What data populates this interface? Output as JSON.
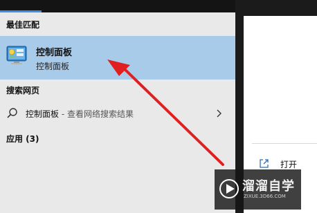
{
  "sections": {
    "best_match": "最佳匹配",
    "web_search": "搜索网页",
    "apps": "应用 (3)"
  },
  "best_match_item": {
    "name": "控制面板",
    "subtitle": "控制面板",
    "icon": "control-panel-icon"
  },
  "web_result": {
    "query": "控制面板",
    "suffix": " - 查看网络搜索结果",
    "icon": "search-icon"
  },
  "right_panel": {
    "open_label": "打开",
    "icon": "open-icon"
  },
  "watermark": {
    "title": "溜溜自学",
    "url": "ZIXUE.3D66.COM"
  },
  "colors": {
    "accent": "#3a8ee6",
    "selected_bg": "#a9cbea",
    "annotation_arrow": "#e02020"
  }
}
